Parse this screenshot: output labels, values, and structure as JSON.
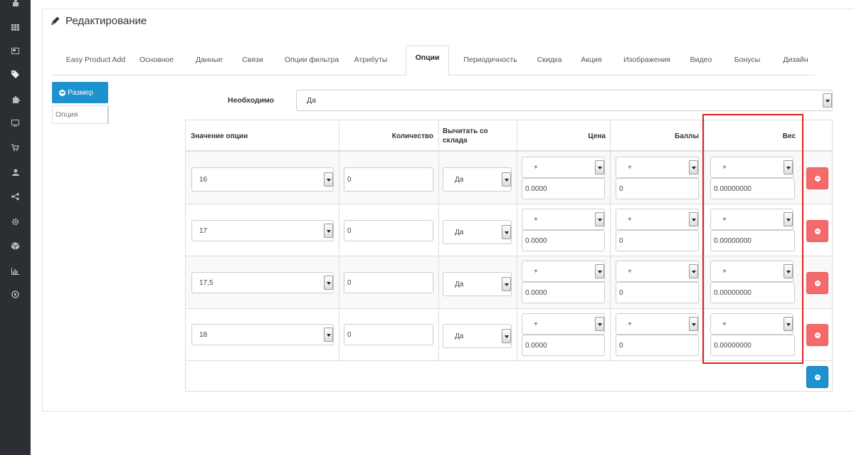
{
  "sidebar": {
    "icons": [
      "user-icon",
      "grid-icon",
      "card-icon",
      "tag-icon",
      "puzzle-icon",
      "monitor-icon",
      "cart-icon",
      "person-icon",
      "share-icon",
      "cog-icon",
      "cube-icon",
      "bar-chart-icon",
      "target-icon"
    ]
  },
  "panel": {
    "title": "Редактирование"
  },
  "tabs": [
    {
      "label": "Easy Product Add"
    },
    {
      "label": "Основное"
    },
    {
      "label": "Данные"
    },
    {
      "label": "Связи"
    },
    {
      "label": "Опции фильтра"
    },
    {
      "label": "Атрибуты"
    },
    {
      "label": "Опции"
    },
    {
      "label": "Периодичность"
    },
    {
      "label": "Скидка"
    },
    {
      "label": "Акция"
    },
    {
      "label": "Изображения"
    },
    {
      "label": "Видео"
    },
    {
      "label": "Бонусы"
    },
    {
      "label": "Дизайн"
    }
  ],
  "option_list": {
    "active": "Размер",
    "input_placeholder": "Опция"
  },
  "required": {
    "label": "Необходимо",
    "value": "Да"
  },
  "table": {
    "headers": {
      "value": "Значение опции",
      "quantity": "Количество",
      "subtract": "Вычитать со склада",
      "price": "Цена",
      "points": "Баллы",
      "weight": "Вес"
    },
    "rows": [
      {
        "value": "16",
        "quantity": "0",
        "subtract": "Да",
        "price_prefix": "+",
        "price": "0.0000",
        "points_prefix": "+",
        "points": "0",
        "weight_prefix": "+",
        "weight": "0.00000000"
      },
      {
        "value": "17",
        "quantity": "0",
        "subtract": "Да",
        "price_prefix": "+",
        "price": "0.0000",
        "points_prefix": "+",
        "points": "0",
        "weight_prefix": "+",
        "weight": "0.00000000"
      },
      {
        "value": "17,5",
        "quantity": "0",
        "subtract": "Да",
        "price_prefix": "+",
        "price": "0.0000",
        "points_prefix": "+",
        "points": "0",
        "weight_prefix": "+",
        "weight": "0.00000000"
      },
      {
        "value": "18",
        "quantity": "0",
        "subtract": "Да",
        "price_prefix": "+",
        "price": "0.0000",
        "points_prefix": "+",
        "points": "0",
        "weight_prefix": "+",
        "weight": "0.00000000"
      }
    ]
  },
  "colors": {
    "primary": "#1e91cf",
    "danger": "#f56b6b",
    "highlight": "#e02020"
  }
}
